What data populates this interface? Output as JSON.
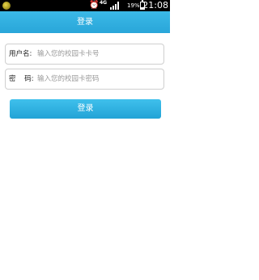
{
  "status_bar": {
    "network_label": "4G",
    "battery_text": "19%",
    "battery_level": 0.19,
    "time": "21:08",
    "app_icon": "round-app-icon",
    "alarm_icon": "alarm-clock-icon",
    "signal_icon": "signal-bars-icon",
    "battery_icon": "battery-icon"
  },
  "header": {
    "title": "登录"
  },
  "form": {
    "username_label": "用户名:",
    "username_placeholder": "输入您的校园卡卡号",
    "password_label": "密    码:",
    "password_placeholder": "输入您的校园卡密码",
    "login_button_label": "登录"
  },
  "colors": {
    "header_bg": "#33b0e0",
    "button_bg": "#2fb3e4",
    "status_bar_bg": "#000000"
  }
}
